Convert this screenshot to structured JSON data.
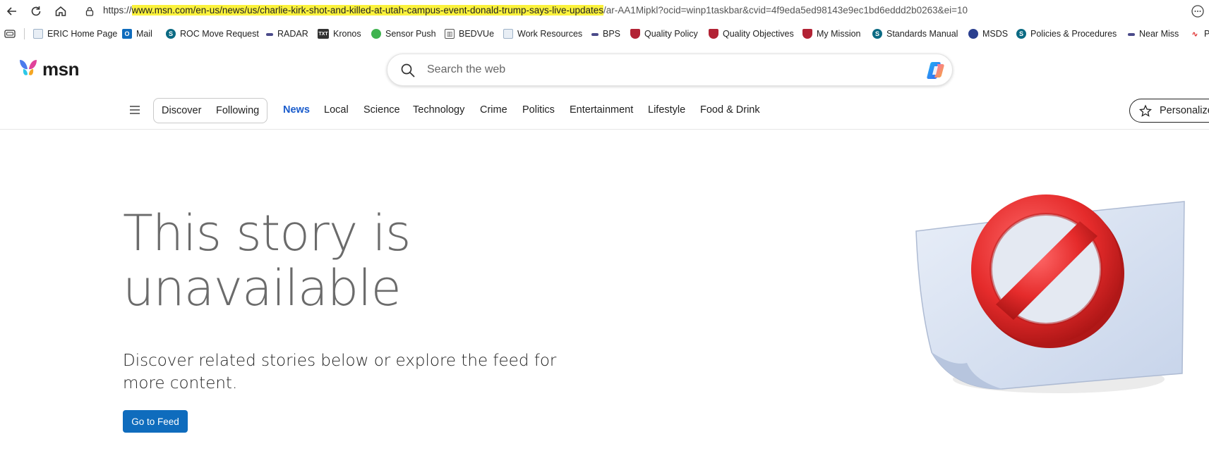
{
  "browser": {
    "url_prefix": "https://",
    "url_highlight": "www.msn.com/en-us/news/us/charlie-kirk-shot-and-killed-at-utah-campus-event-donald-trump-says-live-updates",
    "url_rest": "/ar-AA1Mipkl?ocid=winp1taskbar&cvid=4f9eda5ed98143e9ec1bd6eddd2b0263&ei=10",
    "highlight_color": "#fbf23c"
  },
  "bookmarks": [
    {
      "label": "ERIC Home Page",
      "icon": "page-icon"
    },
    {
      "label": "Mail",
      "icon": "outlook-icon"
    },
    {
      "label": "ROC Move Request",
      "icon": "sharepoint-icon"
    },
    {
      "label": "RADAR",
      "icon": "dash-icon"
    },
    {
      "label": "Kronos",
      "icon": "txt-icon"
    },
    {
      "label": "Sensor Push",
      "icon": "leaf-icon"
    },
    {
      "label": "BEDVUe",
      "icon": "chart-icon"
    },
    {
      "label": "Work Resources",
      "icon": "page-icon"
    },
    {
      "label": "BPS",
      "icon": "dash-icon"
    },
    {
      "label": "Quality Policy",
      "icon": "shield-icon"
    },
    {
      "label": "Quality Objectives",
      "icon": "shield-icon"
    },
    {
      "label": "My Mission",
      "icon": "shield-icon"
    },
    {
      "label": "Standards Manual",
      "icon": "sharepoint-icon"
    },
    {
      "label": "MSDS",
      "icon": "globe-icon"
    },
    {
      "label": "Policies & Procedures",
      "icon": "sharepoint-icon"
    },
    {
      "label": "Near Miss",
      "icon": "dash-icon"
    },
    {
      "label": "P",
      "icon": "scribble-icon"
    }
  ],
  "header": {
    "logo_text": "msn",
    "search_placeholder": "Search the web"
  },
  "nav": {
    "segments": [
      "Discover",
      "Following"
    ],
    "links": [
      "News",
      "Local",
      "Science",
      "Technology",
      "Crime",
      "Politics",
      "Entertainment",
      "Lifestyle",
      "Food & Drink"
    ],
    "active": "News",
    "personalize_label": "Personalize"
  },
  "main": {
    "headline_line1": "This story is",
    "headline_line2": "unavailable",
    "subtext_line1": "Discover related stories below or explore the feed for",
    "subtext_line2": "more content.",
    "feed_button": "Go to Feed"
  },
  "colors": {
    "accent": "#0f6cbd",
    "nav_active": "#1a5ccc",
    "headline": "#6b6b6b",
    "prohibited_red": "#e52b2b"
  }
}
